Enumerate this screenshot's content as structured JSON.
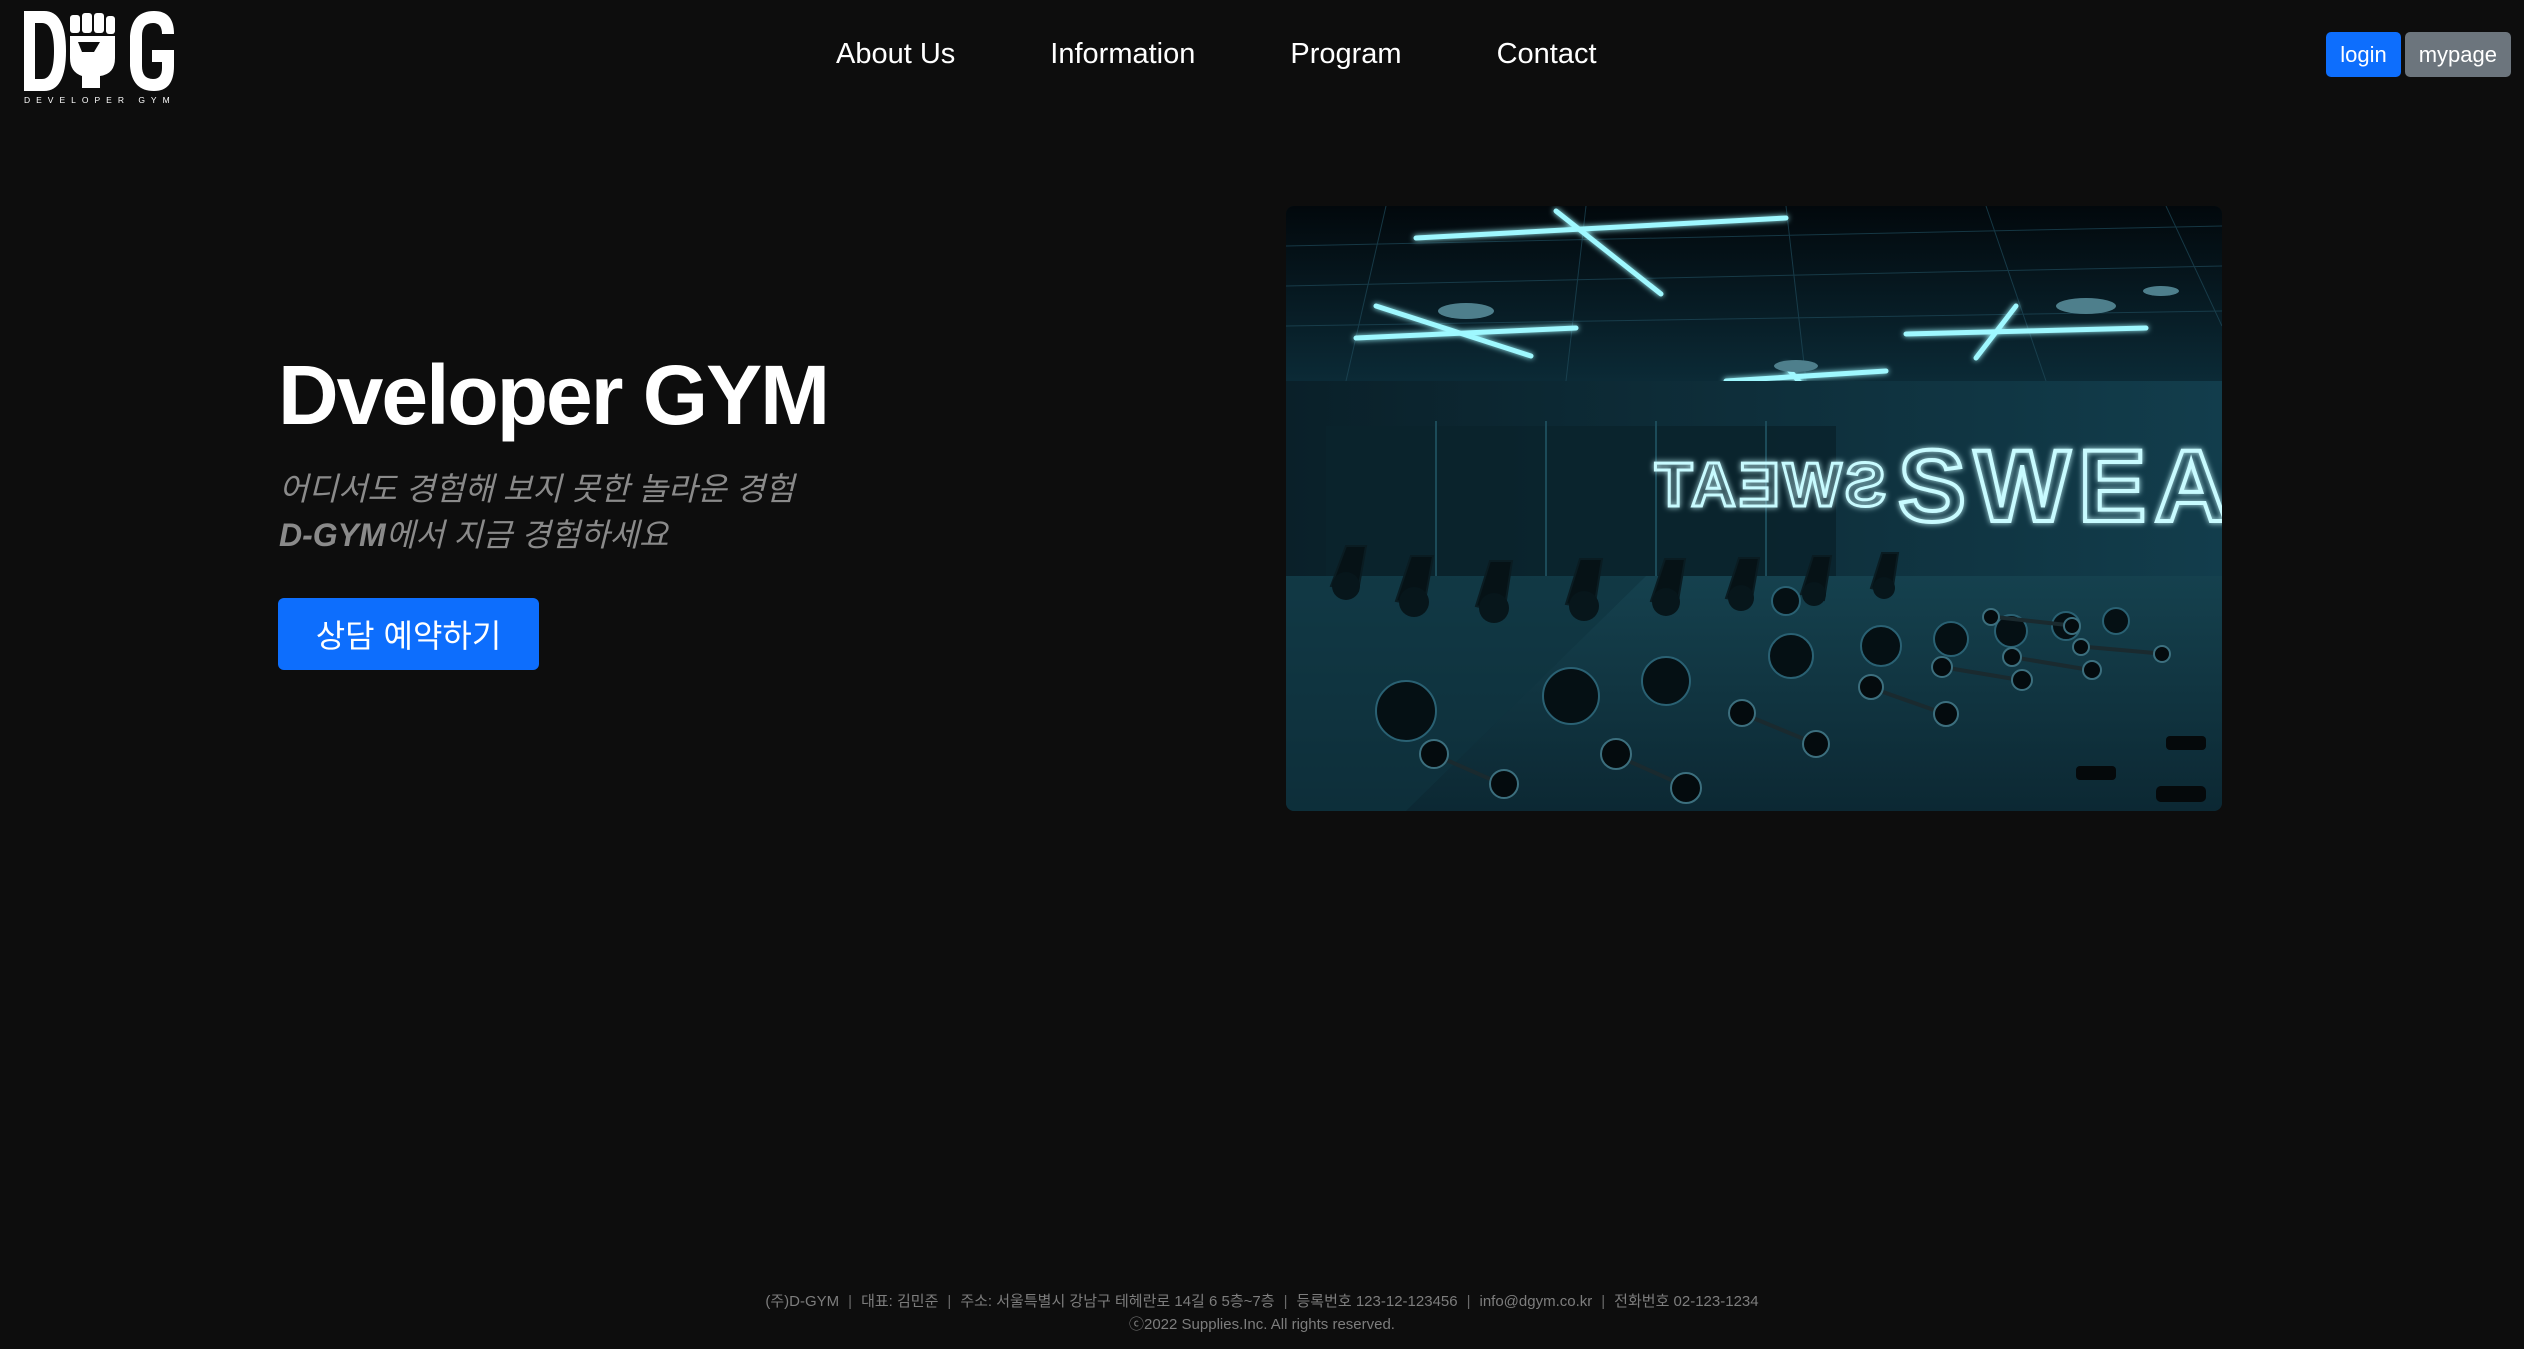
{
  "header": {
    "logo": {
      "mark": "DG",
      "caption": "DEVELOPER GYM",
      "icon": "fist-icon"
    },
    "nav": [
      {
        "label": "About Us"
      },
      {
        "label": "Information"
      },
      {
        "label": "Program"
      },
      {
        "label": "Contact"
      }
    ],
    "login_label": "login",
    "mypage_label": "mypage"
  },
  "hero": {
    "title": "Dveloper GYM",
    "subtitle_line1": "어디서도 경험해 보지 못한 놀라운 경험",
    "subtitle_brand": "D-GYM",
    "subtitle_line2_rest": "에서 지금 경험하세요",
    "cta_label": "상담 예약하기",
    "image": {
      "neon_text": "SWEAT",
      "neon_mirror_text": "SWEAT"
    }
  },
  "footer": {
    "items": [
      "(주)D-GYM",
      "대표: 김민준",
      "주소: 서울특별시 강남구 테헤란로 14길 6 5층~7층",
      "등록번호 123-12-123456",
      "info@dgym.co.kr",
      "전화번호 02-123-1234"
    ],
    "copyright": "ⓒ2022 Supplies.Inc. All rights reserved."
  },
  "colors": {
    "background": "#0d0d0d",
    "primary": "#0d6efd",
    "secondary": "#6c757d",
    "neon": "#7ff3ff"
  }
}
